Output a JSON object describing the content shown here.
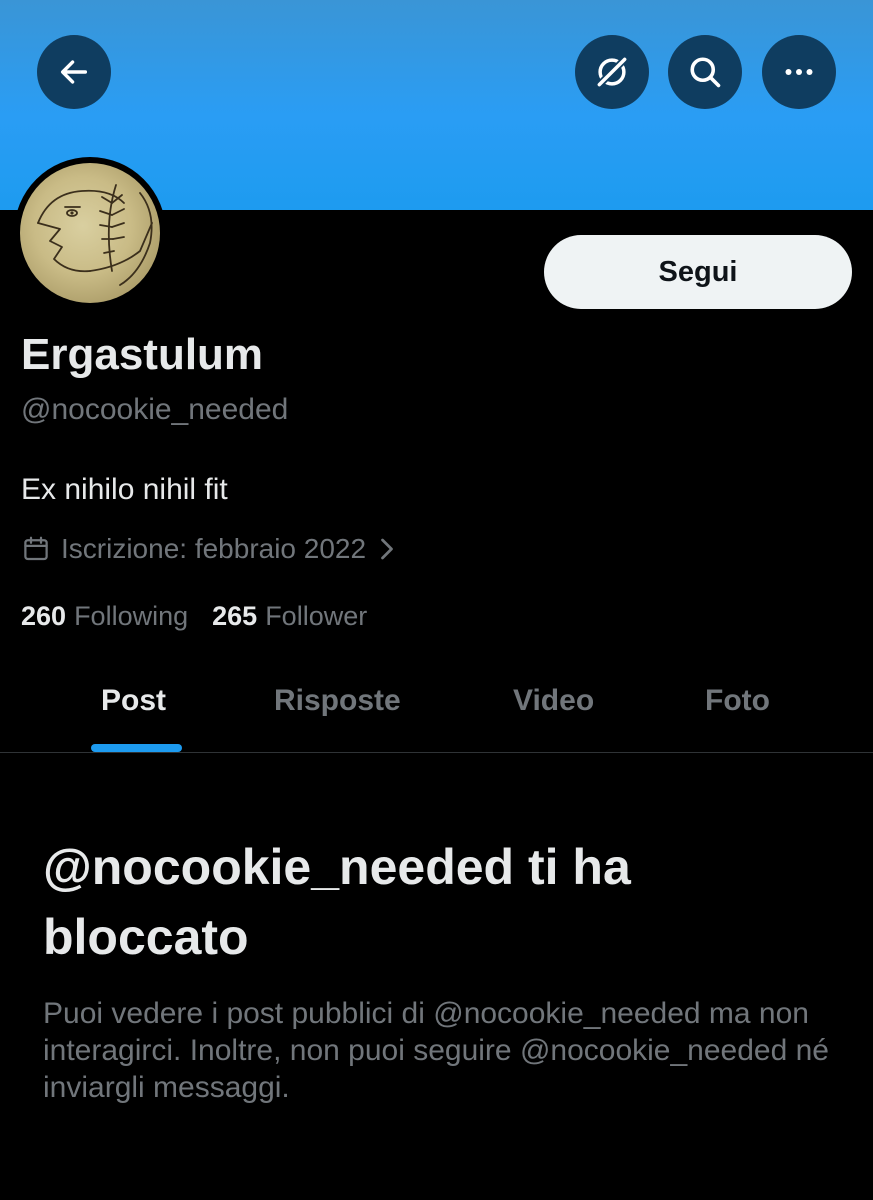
{
  "header": {
    "back_icon": "arrow-left-icon",
    "grok_icon": "grok-icon",
    "search_icon": "search-icon",
    "more_icon": "more-horizontal-icon",
    "banner_color": "#1d9bf0"
  },
  "profile": {
    "display_name": "Ergastulum",
    "handle": "@nocookie_needed",
    "bio": "Ex nihilo nihil fit",
    "joined": "Iscrizione: febbraio 2022",
    "follow_label": "Segui",
    "following_count": "260",
    "following_label": "Following",
    "followers_count": "265",
    "followers_label": "Follower"
  },
  "tabs": [
    {
      "label": "Post",
      "active": true
    },
    {
      "label": "Risposte",
      "active": false
    },
    {
      "label": "Video",
      "active": false
    },
    {
      "label": "Foto",
      "active": false
    }
  ],
  "blocked": {
    "title": "@nocookie_needed ti ha bloccato",
    "message": "Puoi vedere i post pubblici di @nocookie_needed ma non interagirci. Inoltre, non puoi seguire @nocookie_needed né inviargli messaggi."
  },
  "colors": {
    "accent": "#1d9bf0",
    "background": "#000000",
    "text_primary": "#e7e9ea",
    "text_secondary": "#71767b"
  }
}
